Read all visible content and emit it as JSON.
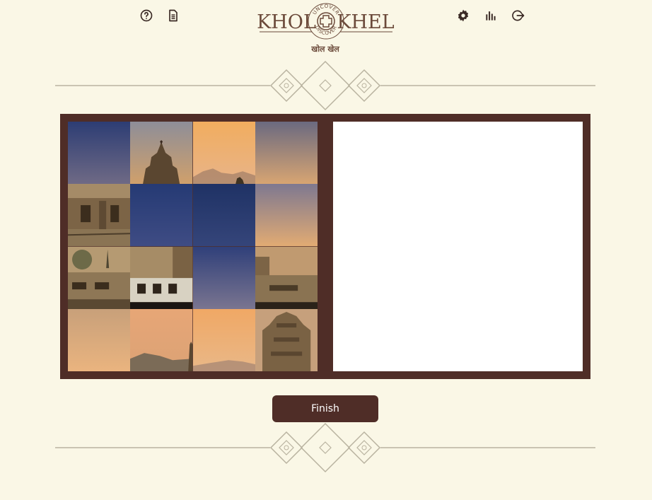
{
  "header": {
    "logo": {
      "left_word": "KHOL",
      "right_word": "KHEL",
      "arc_top": "UNCOVER",
      "arc_bottom": "DISCOVER",
      "subtitle": "खोल खेल"
    },
    "left_icons": [
      "help-icon",
      "document-icon"
    ],
    "right_icons": [
      "gear-icon",
      "stats-icon",
      "logout-icon"
    ]
  },
  "colors": {
    "background": "#faf7e6",
    "frame": "#4f2d27",
    "accent": "#6b4a3a",
    "divider": "#b9b3a0"
  },
  "puzzle": {
    "rows": 4,
    "cols": 4,
    "tiles": [
      "sky-dusk",
      "temple-spire",
      "sunset-hills",
      "sky-fade",
      "ruins-courtyard",
      "sky-deep-blue",
      "sky-deep-blue",
      "sky-fade",
      "ruins-trees",
      "ruins-wall",
      "sky-blue",
      "ruins-steps",
      "sky-haze",
      "hills-spire",
      "sunset-hills",
      "temple-tower"
    ]
  },
  "actions": {
    "finish_label": "Finish"
  }
}
